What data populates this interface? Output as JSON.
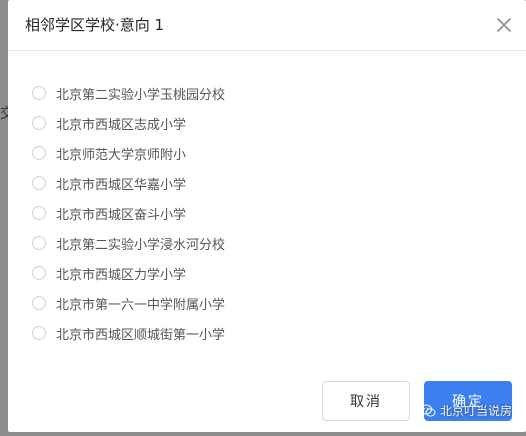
{
  "backdrop": {
    "partial_text": "交"
  },
  "dialog": {
    "title": "相邻学区学校·意向 1",
    "options": [
      {
        "label": "北京第二实验小学玉桃园分校",
        "selected": false
      },
      {
        "label": "北京市西城区志成小学",
        "selected": false
      },
      {
        "label": "北京师范大学京师附小",
        "selected": false
      },
      {
        "label": "北京市西城区华嘉小学",
        "selected": false
      },
      {
        "label": "北京市西城区奋斗小学",
        "selected": false
      },
      {
        "label": "北京第二实验小学浸水河分校",
        "selected": false
      },
      {
        "label": "北京市西城区力学小学",
        "selected": false
      },
      {
        "label": "北京市第一六一中学附属小学",
        "selected": false
      },
      {
        "label": "北京市西城区顺城街第一小学",
        "selected": false
      }
    ],
    "cancel_label": "取消",
    "ok_label": "确定"
  },
  "watermark": {
    "text": "北京叮当说房"
  },
  "colors": {
    "primary": "#3c7ff0",
    "title_text": "#262626",
    "option_text": "#555555",
    "backdrop": "#8c8c8c"
  }
}
